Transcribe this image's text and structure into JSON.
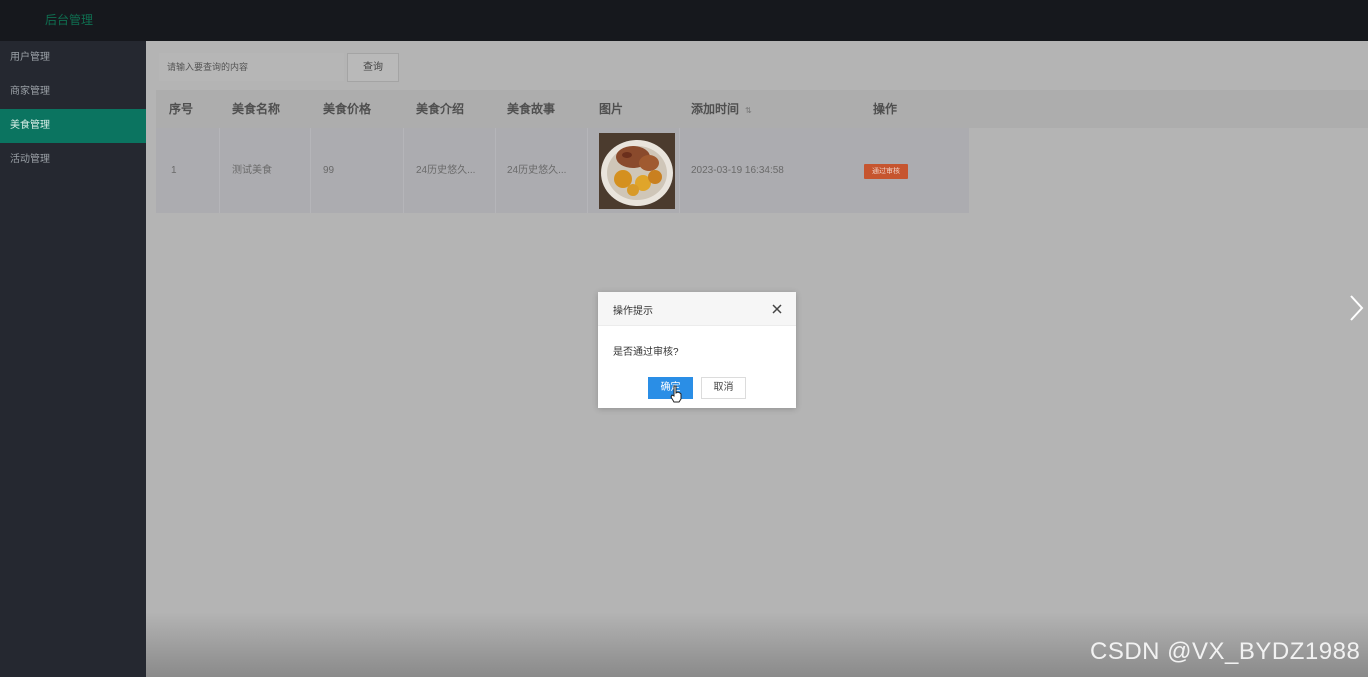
{
  "topbar": {
    "brand": "后台管理"
  },
  "sidebar": {
    "items": [
      {
        "label": "用户管理",
        "active": false
      },
      {
        "label": "商家管理",
        "active": false
      },
      {
        "label": "美食管理",
        "active": true
      },
      {
        "label": "活动管理",
        "active": false
      }
    ]
  },
  "search": {
    "placeholder": "请输入要查询的内容",
    "button_label": "查询"
  },
  "table": {
    "headers": [
      "序号",
      "美食名称",
      "美食价格",
      "美食介绍",
      "美食故事",
      "图片",
      "添加时间",
      "操作"
    ],
    "sort_icon": "sort-arrows-icon",
    "rows": [
      {
        "index": "1",
        "name": "测试美食",
        "price": "99",
        "intro": "24历史悠久...",
        "story": "24历史悠久...",
        "image": "food-photo",
        "added_time": "2023-03-19 16:34:58",
        "action_label": "通过审核"
      }
    ]
  },
  "dialog": {
    "title": "操作提示",
    "message": "是否通过审核?",
    "ok_label": "确定",
    "cancel_label": "取消"
  },
  "watermark": "CSDN @VX_BYDZ1988",
  "colors": {
    "sidebar_active": "#0b7460",
    "approve_button": "#c6552f",
    "ok_button": "#2a8ee6"
  }
}
